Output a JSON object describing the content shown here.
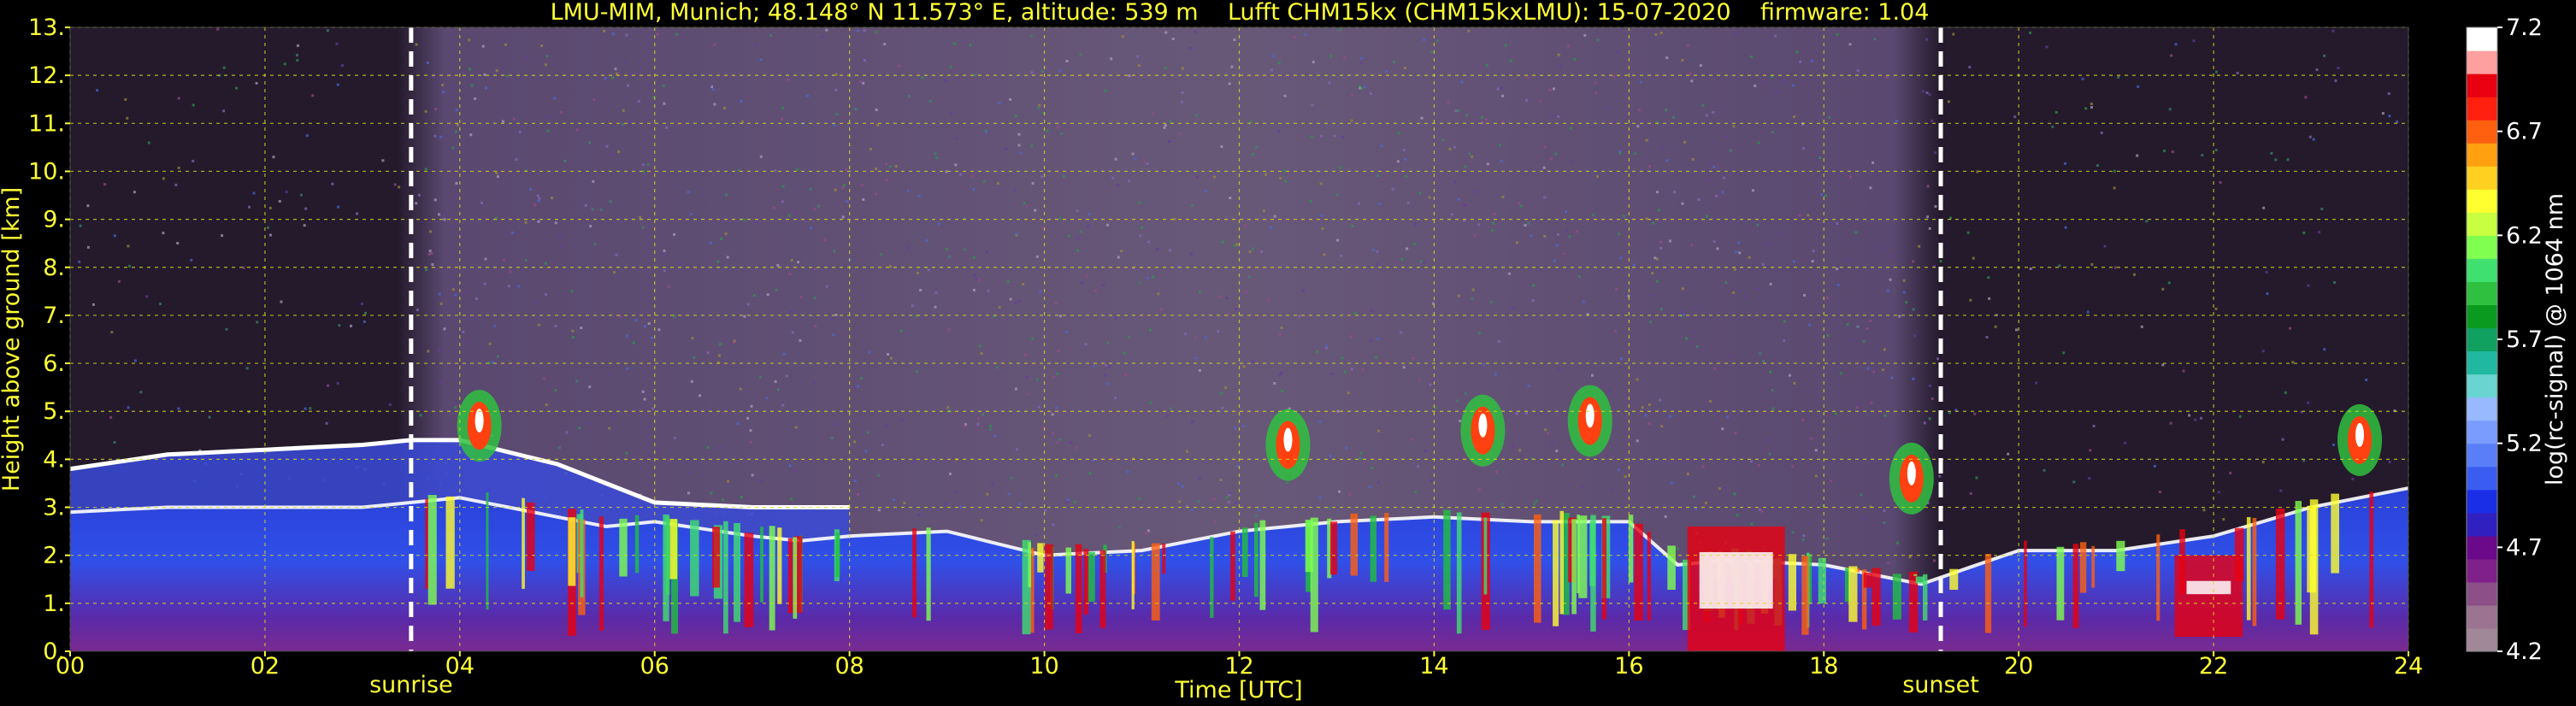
{
  "chart_data": {
    "type": "heatmap",
    "title": "LMU-MIM, Munich; 48.148° N 11.573° E, altitude: 539 m    Lufft CHM15kx (CHM15kxLMU): 15-07-2020    firmware: 1.04",
    "xlabel": "Time [UTC]",
    "ylabel": "Height above ground [km]",
    "xlim": [
      0,
      24
    ],
    "ylim": [
      0,
      13
    ],
    "x_ticks": [
      "00",
      "02",
      "04",
      "06",
      "08",
      "10",
      "12",
      "14",
      "16",
      "18",
      "20",
      "22",
      "24"
    ],
    "y_ticks": [
      "0.",
      "1.",
      "2.",
      "3.",
      "4.",
      "5.",
      "6.",
      "7.",
      "8.",
      "9.",
      "10.",
      "11.",
      "12.",
      "13."
    ],
    "grid": true,
    "annotations": [
      {
        "label": "sunrise",
        "time": 3.5
      },
      {
        "label": "sunset",
        "time": 19.2
      }
    ],
    "colorbar": {
      "label": "log(rc-signal) @ 1064 nm",
      "min": 4.2,
      "max": 7.2,
      "ticks": [
        "4.2",
        "4.7",
        "5.2",
        "5.7",
        "6.2",
        "6.7",
        "7.2"
      ],
      "colors": [
        "#a08898",
        "#9a7490",
        "#8c4f88",
        "#80208a",
        "#6a0a8a",
        "#3020c0",
        "#1a2ee8",
        "#3a5cf0",
        "#5a7ef8",
        "#7a9cff",
        "#98b8ff",
        "#6ad4d0",
        "#20b8a0",
        "#10a060",
        "#0a9a20",
        "#30c040",
        "#40e070",
        "#80ff50",
        "#c8ff40",
        "#ffff30",
        "#ffd020",
        "#ffa010",
        "#ff6010",
        "#ff2010",
        "#e80010",
        "#ffa0a0",
        "#ffffff"
      ]
    },
    "cloud_base_km": [
      [
        0.0,
        2.9
      ],
      [
        1.0,
        3.0
      ],
      [
        2.0,
        3.0
      ],
      [
        3.0,
        3.0
      ],
      [
        3.5,
        3.1
      ],
      [
        4.0,
        3.2
      ],
      [
        5.0,
        2.8
      ],
      [
        5.5,
        2.6
      ],
      [
        6.0,
        2.7
      ],
      [
        7.0,
        2.4
      ],
      [
        7.5,
        2.3
      ],
      [
        8.0,
        2.4
      ],
      [
        9.0,
        2.5
      ],
      [
        10.0,
        2.0
      ],
      [
        11.0,
        2.1
      ],
      [
        12.0,
        2.5
      ],
      [
        13.0,
        2.7
      ],
      [
        14.0,
        2.8
      ],
      [
        15.0,
        2.7
      ],
      [
        16.0,
        2.7
      ],
      [
        16.5,
        1.8
      ],
      [
        17.0,
        1.9
      ],
      [
        18.0,
        1.8
      ],
      [
        19.0,
        1.4
      ],
      [
        20.0,
        2.1
      ],
      [
        21.0,
        2.1
      ],
      [
        22.0,
        2.4
      ],
      [
        23.0,
        3.0
      ],
      [
        24.0,
        3.4
      ]
    ],
    "upper_layer_km": [
      [
        0.0,
        3.8
      ],
      [
        1.0,
        4.1
      ],
      [
        2.0,
        4.2
      ],
      [
        3.0,
        4.3
      ],
      [
        3.5,
        4.4
      ],
      [
        4.0,
        4.4
      ],
      [
        5.0,
        3.9
      ],
      [
        6.0,
        3.1
      ],
      [
        7.0,
        3.0
      ],
      [
        8.0,
        3.0
      ]
    ],
    "high_cells_km": [
      [
        4.2,
        4.7
      ],
      [
        12.5,
        4.3
      ],
      [
        14.5,
        4.6
      ],
      [
        15.6,
        4.8
      ],
      [
        18.9,
        3.6
      ],
      [
        23.5,
        4.4
      ]
    ]
  }
}
